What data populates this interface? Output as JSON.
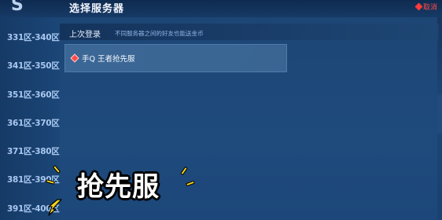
{
  "header": {
    "title": "选择服务器",
    "close_label": "取消",
    "logo_text": "S"
  },
  "sidebar": {
    "zones": [
      {
        "label": "331区-340区"
      },
      {
        "label": "341区-350区"
      },
      {
        "label": "351区-360区"
      },
      {
        "label": "361区-370区"
      },
      {
        "label": "371区-380区"
      },
      {
        "label": "381区-390区"
      },
      {
        "label": "391区-400区"
      }
    ]
  },
  "tabs": {
    "recent_label": "上次登录",
    "hint": "不同服务器之间的好友也能送金币"
  },
  "servers": [
    {
      "name": "手Q 王者抢先服"
    }
  ],
  "overlay": {
    "caption": "抢先服"
  },
  "colors": {
    "accent_red": "#ff4a4a",
    "caption_yellow": "#f3d21c",
    "bg_blue": "#1d4675"
  }
}
